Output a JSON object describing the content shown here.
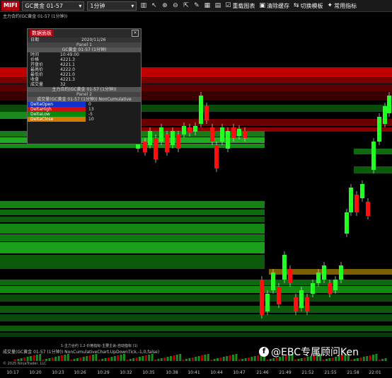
{
  "toolbar": {
    "brand": "MIFI",
    "instrument": "GC黄金 01-57",
    "interval": "1分钟",
    "buttons": [
      "重载图表",
      "清除缓存",
      "切换模板",
      "常用指标"
    ],
    "icons": [
      "bar-chart-icon",
      "cursor-icon",
      "zoom-in-icon",
      "zoom-out-icon",
      "pointer-icon",
      "pencil-icon",
      "grid-icon",
      "properties-icon",
      "data-box-icon",
      "indicators-icon"
    ]
  },
  "chart": {
    "title": "主力合约(GC黄金 01-57 (1分钟))",
    "legend_text": "1-主力合约 1.2-价格指标-主要主会-自动指标 (1)",
    "lower_panel_title": "成交量(GC黄金 01-57 (1分钟)) NonCumulativeChart.UpDownTick,-1,0,false)",
    "copyright": "© 2025 NinjaTrader, LLC",
    "x_ticks": [
      "10:17",
      "10:20",
      "10:23",
      "10:26",
      "10:29",
      "10:32",
      "10:35",
      "10:38",
      "10:41",
      "10:44",
      "10:47",
      "21:46",
      "21:49",
      "21:52",
      "21:55",
      "21:58",
      "22:01"
    ]
  },
  "data_panel": {
    "title": "数据面板",
    "date_label": "日期",
    "date_value": "2020/11/26",
    "panel1": "Panel 1",
    "instrument_band": "GC黄金 01-57 (1分钟)",
    "rows": [
      {
        "k": "时间",
        "v": "10:49:00"
      },
      {
        "k": "价格",
        "v": "4221.3"
      },
      {
        "k": "开盘价",
        "v": "4221.1"
      },
      {
        "k": "最高价",
        "v": "4222.0"
      },
      {
        "k": "最低价",
        "v": "4221.0"
      },
      {
        "k": "收盘",
        "v": "4221.3"
      },
      {
        "k": "成交量",
        "v": "32"
      }
    ],
    "sub_band": "主力合约(GC黄金 01-57 (1分钟))",
    "panel2": "Panel 2",
    "sub_band2": "成交量(GC黄金 01-57 (1分钟)) NonCumulative",
    "delta": [
      {
        "k": "DeltaOpen",
        "v": "0",
        "color": "#1030d0"
      },
      {
        "k": "DeltaHigh",
        "v": "13",
        "color": "#d01010"
      },
      {
        "k": "DeltaLow",
        "v": "-5",
        "color": "#0a8a0a"
      },
      {
        "k": "DeltaClose",
        "v": "10",
        "color": "#d07a00"
      }
    ]
  },
  "watermark": "@EBC专属顾问Ken",
  "colors": {
    "bull": "#22ff22",
    "bear": "#ff1010",
    "band_red": "#8a0000",
    "band_green": "#0a6a0a"
  }
}
